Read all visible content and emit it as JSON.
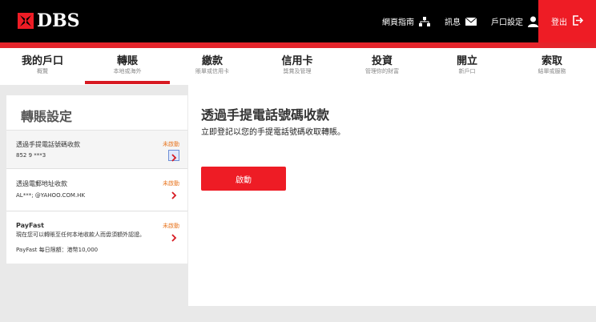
{
  "header": {
    "logo_text": "DBS",
    "links": [
      {
        "label": "網頁指南",
        "icon": "sitemap-icon"
      },
      {
        "label": "訊息",
        "icon": "envelope-icon"
      },
      {
        "label": "戶口設定",
        "icon": "user-icon"
      }
    ],
    "logout_label": "登出",
    "logout_icon": "logout-icon"
  },
  "nav": {
    "items": [
      {
        "title": "我的戶口",
        "sub": "概覽"
      },
      {
        "title": "轉賬",
        "sub": "本地或海外"
      },
      {
        "title": "繳款",
        "sub": "賬單或信用卡"
      },
      {
        "title": "信用卡",
        "sub": "獎賞及管理"
      },
      {
        "title": "投資",
        "sub": "管理你的財富"
      },
      {
        "title": "開立",
        "sub": "新戶口"
      },
      {
        "title": "索取",
        "sub": "結單或服務"
      }
    ],
    "active_index": 1
  },
  "settings_panel": {
    "title": "轉賬設定",
    "rows": [
      {
        "title": "透過手提電話號碼收款",
        "detail": "852 9          ***3",
        "status": "未啟動"
      },
      {
        "title": "透過電郵地址收款",
        "detail": "AL***;           @YAHOO.COM.HK",
        "status": "未啟動"
      },
      {
        "title": "PayFast",
        "desc": "現在您可以轉賬至任何本地收款人而毋須額外認證。",
        "detail": "PayFast 每日限額：港幣10,000",
        "status": "未啟動"
      }
    ]
  },
  "content": {
    "title": "透過手提電話號碼收款",
    "description": "立即登記以您的手提電話號碼收取轉賬。",
    "button_label": "啟動"
  },
  "colors": {
    "brand_red": "#ee1c25",
    "status_orange": "#e87722",
    "background_grey": "#e9e9e9"
  }
}
